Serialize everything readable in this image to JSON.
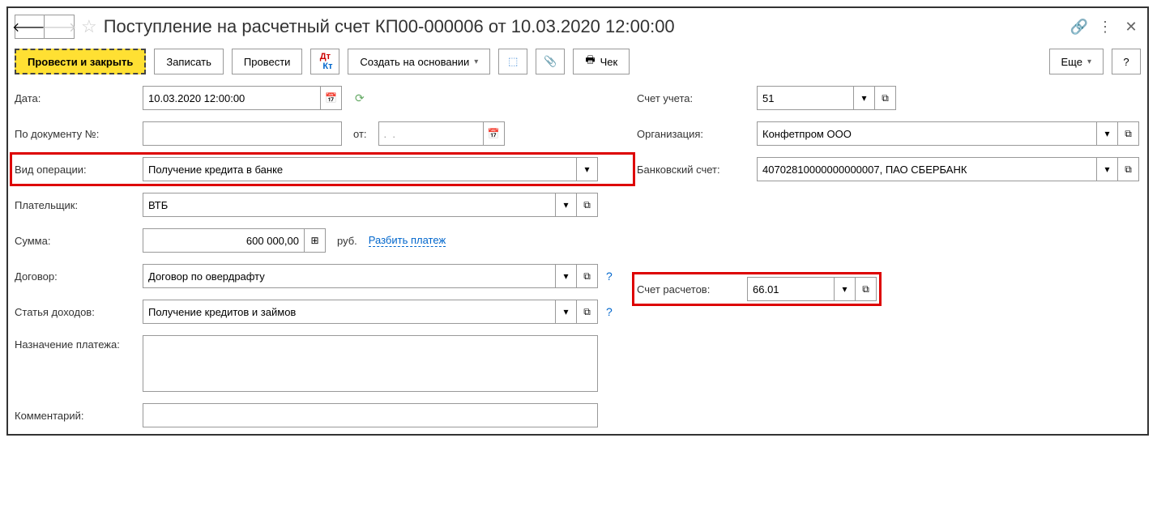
{
  "header": {
    "title": "Поступление на расчетный счет КП00-000006 от 10.03.2020 12:00:00"
  },
  "toolbar": {
    "post_and_close": "Провести и закрыть",
    "save": "Записать",
    "post": "Провести",
    "create_based": "Создать на основании",
    "cheque": "Чек",
    "more": "Еще"
  },
  "labels": {
    "date": "Дата:",
    "doc_number": "По документу №:",
    "from": "от:",
    "operation_type": "Вид операции:",
    "payer": "Плательщик:",
    "amount": "Сумма:",
    "currency": "руб.",
    "split_payment": "Разбить платеж",
    "contract": "Договор:",
    "income_item": "Статья доходов:",
    "purpose": "Назначение платежа:",
    "comment": "Комментарий:",
    "account": "Счет учета:",
    "organization": "Организация:",
    "bank_account": "Банковский счет:",
    "settlement_account": "Счет расчетов:"
  },
  "values": {
    "date": "10.03.2020 12:00:00",
    "doc_number": "",
    "from_date": ".  .",
    "operation_type": "Получение кредита в банке",
    "payer": "ВТБ",
    "amount": "600 000,00",
    "contract": "Договор по овердрафту",
    "income_item": "Получение кредитов и займов",
    "purpose": "",
    "comment": "",
    "account": "51",
    "organization": "Конфетпром ООО",
    "bank_account": "40702810000000000007, ПАО СБЕРБАНК",
    "settlement_account": "66.01"
  }
}
